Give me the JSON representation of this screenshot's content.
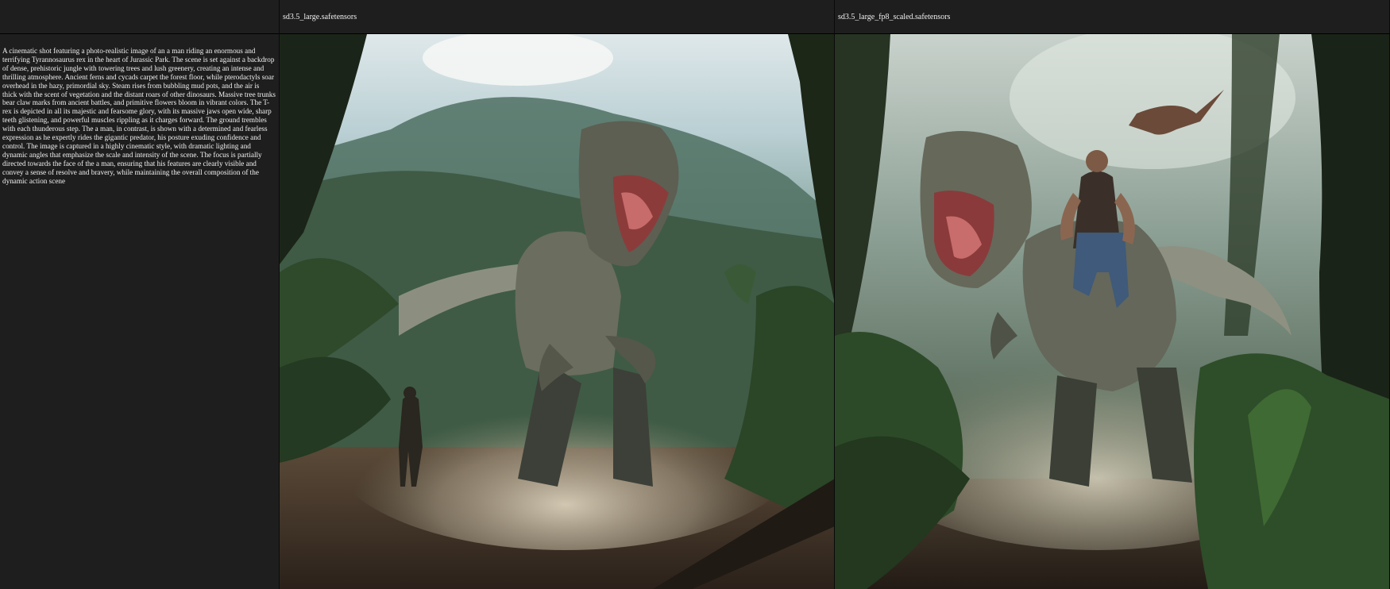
{
  "columns": [
    {
      "header": "sd3.5_large.safetensors"
    },
    {
      "header": "sd3.5_large_fp8_scaled.safetensors"
    }
  ],
  "prompt": "A cinematic shot featuring a photo-realistic image of an a man riding an enormous and terrifying Tyrannosaurus rex in the heart of Jurassic Park. The scene is set against a backdrop of dense, prehistoric jungle with towering trees and lush greenery, creating an intense and thrilling atmosphere. Ancient ferns and cycads carpet the forest floor, while pterodactyls soar overhead in the hazy, primordial sky. Steam rises from bubbling mud pots, and the air is thick with the scent of vegetation and the distant roars of other dinosaurs. Massive tree trunks bear claw marks from ancient battles, and primitive flowers bloom in vibrant colors. The T-rex is depicted in all its majestic and fearsome glory, with its massive jaws open wide, sharp teeth glistening, and powerful muscles rippling as it charges forward. The ground trembles with each thunderous step. The a man, in contrast, is shown with a determined and fearless expression as he expertly rides the gigantic predator, his posture exuding confidence and control. The image is captured in a highly cinematic style, with dramatic lighting and dynamic angles that emphasize the scale and intensity of the scene. The focus is partially directed towards the face of the a man, ensuring that his features are clearly visible and convey a sense of resolve and bravery, while maintaining the overall composition of the dynamic action scene",
  "images": [
    {
      "subject": "t-rex-charging-man-standing"
    },
    {
      "subject": "man-riding-t-rex-pterodactyl"
    }
  ]
}
